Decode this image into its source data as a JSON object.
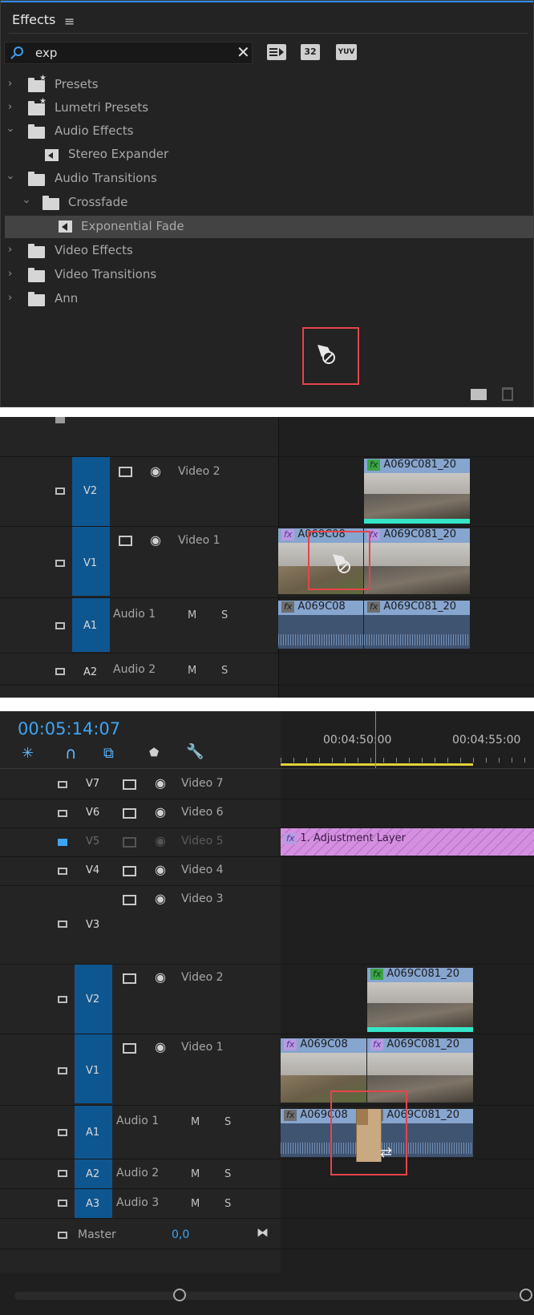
{
  "effects_panel": {
    "title": "Effects",
    "search_value": "exp",
    "toolbar_badges": [
      "32",
      "YUV"
    ],
    "tree": [
      {
        "label": "Presets",
        "kind": "preset-folder"
      },
      {
        "label": "Lumetri Presets",
        "kind": "preset-folder"
      },
      {
        "label": "Audio Effects",
        "kind": "folder"
      },
      {
        "label": "Stereo Expander",
        "kind": "audio-effect"
      },
      {
        "label": "Audio Transitions",
        "kind": "folder"
      },
      {
        "label": "Crossfade",
        "kind": "folder"
      },
      {
        "label": "Exponential Fade",
        "kind": "audio-transition"
      },
      {
        "label": "Video Effects",
        "kind": "folder"
      },
      {
        "label": "Video Transitions",
        "kind": "folder"
      },
      {
        "label": "Ann",
        "kind": "folder"
      }
    ]
  },
  "timeline_mid": {
    "tracks": {
      "v2_tag": "V2",
      "v2_name": "Video 2",
      "v1_tag": "V1",
      "v1_name": "Video 1",
      "a1_tag": "A1",
      "a1_name": "Audio 1",
      "a2_tag": "A2",
      "a2_name": "Audio 2",
      "m": "M",
      "s": "S"
    },
    "clips": {
      "v2_clip": "A069C081_20",
      "v1_left": "A069C08",
      "v1_right": "A069C081_20",
      "a1_left": "A069C08",
      "a1_right": "A069C081_20",
      "fx": "fx"
    }
  },
  "timeline_bottom": {
    "timecode": "00:05:14:07",
    "ruler": [
      "00:04:50:00",
      "00:04:55:00"
    ],
    "tracks": {
      "v7_tag": "V7",
      "v7_name": "Video 7",
      "v6_tag": "V6",
      "v6_name": "Video 6",
      "v5_tag": "V5",
      "v5_name": "Video 5",
      "v4_tag": "V4",
      "v4_name": "Video 4",
      "v3_tag": "V3",
      "v3_name": "Video 3",
      "v2_tag": "V2",
      "v2_name": "Video 2",
      "v1_tag": "V1",
      "v1_name": "Video 1",
      "a1_tag": "A1",
      "a1_name": "Audio 1",
      "a2_tag": "A2",
      "a2_name": "Audio 2",
      "a3_tag": "A3",
      "a3_name": "Audio 3",
      "master": "Master",
      "master_value": "0,0",
      "m": "M",
      "s": "S"
    },
    "clips": {
      "adjustment_layer": "1. Adjustment Layer",
      "v2_clip": "A069C081_20",
      "v1_left": "A069C08",
      "v1_right": "A069C081_20",
      "a1_left": "A069C08",
      "a1_right": "A069C081_20",
      "fx": "fx"
    }
  }
}
